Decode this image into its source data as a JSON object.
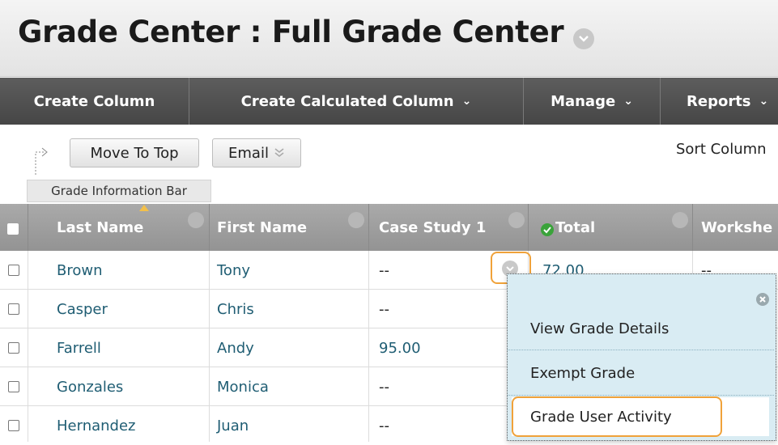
{
  "page": {
    "title": "Grade Center : Full Grade Center"
  },
  "action_bar": {
    "items": [
      {
        "label": "Create Column"
      },
      {
        "label": "Create Calculated Column",
        "dropdown": true
      },
      {
        "label": "Manage",
        "dropdown": true
      },
      {
        "label": "Reports",
        "dropdown": true
      }
    ]
  },
  "toolbar": {
    "move_to_top": "Move To Top",
    "email": "Email",
    "sort_columns": "Sort Column",
    "grade_info_bar": "Grade Information Bar"
  },
  "grid": {
    "columns": [
      "Last Name",
      "First Name",
      "Case Study 1",
      "Total",
      "Workshe"
    ],
    "rows": [
      {
        "last": "Brown",
        "first": "Tony",
        "case": "--",
        "total": "72.00",
        "work": "--"
      },
      {
        "last": "Casper",
        "first": "Chris",
        "case": "--",
        "total": "",
        "work": ""
      },
      {
        "last": "Farrell",
        "first": "Andy",
        "case": "95.00",
        "total": "",
        "work": ""
      },
      {
        "last": "Gonzales",
        "first": "Monica",
        "case": "--",
        "total": "",
        "work": ""
      },
      {
        "last": "Hernandez",
        "first": "Juan",
        "case": "--",
        "total": "",
        "work": ""
      }
    ]
  },
  "context_menu": {
    "items": [
      "View Grade Details",
      "Exempt Grade",
      "Grade User Activity"
    ],
    "highlighted": "Grade User Activity"
  },
  "colors": {
    "link": "#1f5d73",
    "highlight": "#f0a23a",
    "menu_bg": "#d9ecf3",
    "action_bar": "#4f4f4f",
    "header_row": "#9e9e9e"
  }
}
